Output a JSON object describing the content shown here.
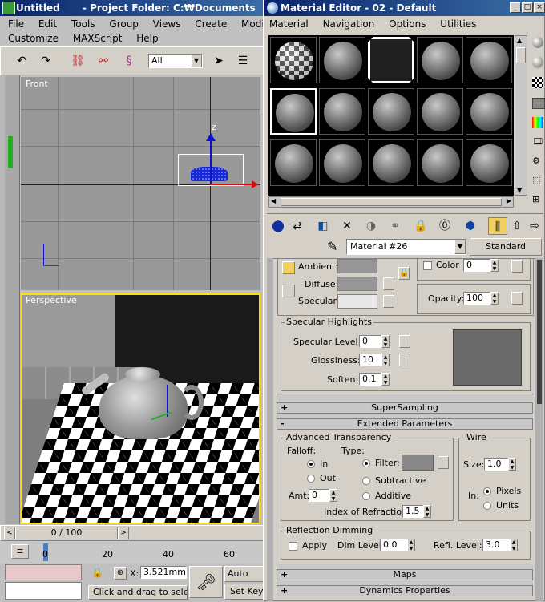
{
  "main_window": {
    "title": "Untitled",
    "project": "- Project Folder: C:₩Documents",
    "menu1": [
      "File",
      "Edit",
      "Tools",
      "Group",
      "Views",
      "Create",
      "Modifiers"
    ],
    "menu2": [
      "Customize",
      "MAXScript",
      "Help"
    ],
    "selection_filter": "All"
  },
  "viewports": {
    "front_label": "Front",
    "persp_label": "Perspective"
  },
  "timeline": {
    "frame_display": "0 / 100",
    "ticks": [
      "0",
      "20",
      "40",
      "60"
    ]
  },
  "status": {
    "coord_value": "3.521mm",
    "prompt": "Click and drag to select",
    "autokey": "Auto Key",
    "setkey": "Set Key"
  },
  "material_editor": {
    "title": "Material Editor - 02 - Default",
    "menu": [
      "Material",
      "Navigation",
      "Options",
      "Utilities"
    ],
    "material_name": "Material #26",
    "material_type": "Standard",
    "ambient_label": "Ambient:",
    "diffuse_label": "Diffuse:",
    "specular_label": "Specular:",
    "color_label": "Color",
    "color_value": "0",
    "opacity_label": "Opacity:",
    "opacity_value": "100",
    "specular_highlights": {
      "title": "Specular Highlights",
      "level_label": "Specular Level:",
      "level_value": "0",
      "gloss_label": "Glossiness:",
      "gloss_value": "10",
      "soften_label": "Soften:",
      "soften_value": "0.1"
    },
    "rollouts": {
      "supersampling": "SuperSampling",
      "extended": "Extended Parameters",
      "maps": "Maps",
      "dynamics": "Dynamics Properties"
    },
    "adv_transparency": {
      "title": "Advanced Transparency",
      "falloff": "Falloff:",
      "type": "Type:",
      "in": "In",
      "out": "Out",
      "filter": "Filter:",
      "subtractive": "Subtractive",
      "additive": "Additive",
      "amt_label": "Amt:",
      "amt_value": "0",
      "ior_label": "Index of Refraction:",
      "ior_value": "1.5"
    },
    "wire": {
      "title": "Wire",
      "size_label": "Size:",
      "size_value": "1.0",
      "in_label": "In:",
      "pixels": "Pixels",
      "units": "Units"
    },
    "reflection_dimming": {
      "title": "Reflection Dimming",
      "apply": "Apply",
      "dim_label": "Dim Level:",
      "dim_value": "0.0",
      "refl_label": "Refl. Level:",
      "refl_value": "3.0"
    }
  }
}
